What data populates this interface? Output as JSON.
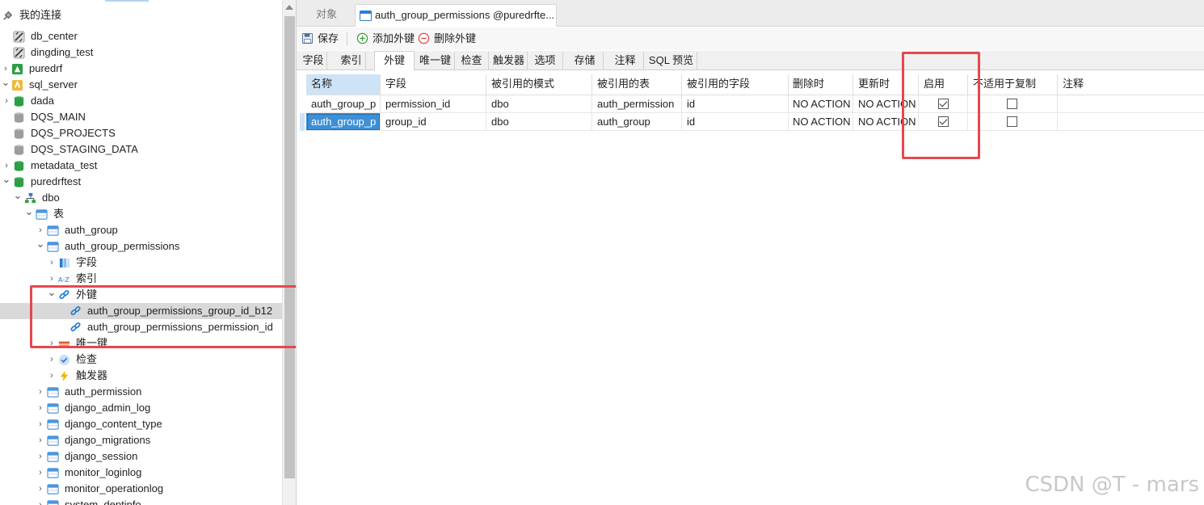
{
  "tree": {
    "root_label": "我的连接",
    "rows": [
      {
        "label": "db_center",
        "icon": "connection-disabled-icon",
        "twisty": ""
      },
      {
        "label": "dingding_test",
        "icon": "connection-disabled-icon",
        "twisty": ""
      },
      {
        "label": "puredrf",
        "icon": "connection-green-icon",
        "twisty": ">"
      },
      {
        "label": "sql_server",
        "icon": "connection-active-icon",
        "twisty": "v"
      },
      {
        "label": "dada",
        "icon": "database-green-icon",
        "twisty": ">"
      },
      {
        "label": "DQS_MAIN",
        "icon": "database-gray-icon",
        "twisty": ""
      },
      {
        "label": "DQS_PROJECTS",
        "icon": "database-gray-icon",
        "twisty": ""
      },
      {
        "label": "DQS_STAGING_DATA",
        "icon": "database-gray-icon",
        "twisty": ""
      },
      {
        "label": "metadata_test",
        "icon": "database-green-icon",
        "twisty": ">"
      },
      {
        "label": "puredrftest",
        "icon": "database-green-icon",
        "twisty": "v"
      },
      {
        "label": "dbo",
        "icon": "schema-icon",
        "twisty": "v"
      },
      {
        "label": "表",
        "icon": "tables-folder-icon",
        "twisty": "v"
      },
      {
        "label": "auth_group",
        "icon": "table-icon",
        "twisty": ">"
      },
      {
        "label": "auth_group_permissions",
        "icon": "table-icon",
        "twisty": "v"
      },
      {
        "label": "字段",
        "icon": "fields-icon",
        "twisty": ">"
      },
      {
        "label": "索引",
        "icon": "index-az-icon",
        "twisty": ">"
      },
      {
        "label": "外键",
        "icon": "foreign-key-icon",
        "twisty": "v"
      },
      {
        "label": "auth_group_permissions_group_id_b12",
        "icon": "foreign-key-icon",
        "twisty": ""
      },
      {
        "label": "auth_group_permissions_permission_id",
        "icon": "foreign-key-icon",
        "twisty": ""
      },
      {
        "label": "唯一键",
        "icon": "unique-key-icon",
        "twisty": ">"
      },
      {
        "label": "检查",
        "icon": "check-icon",
        "twisty": ">"
      },
      {
        "label": "触发器",
        "icon": "trigger-icon",
        "twisty": ">"
      },
      {
        "label": "auth_permission",
        "icon": "table-icon",
        "twisty": ">"
      },
      {
        "label": "django_admin_log",
        "icon": "table-icon",
        "twisty": ">"
      },
      {
        "label": "django_content_type",
        "icon": "table-icon",
        "twisty": ">"
      },
      {
        "label": "django_migrations",
        "icon": "table-icon",
        "twisty": ">"
      },
      {
        "label": "django_session",
        "icon": "table-icon",
        "twisty": ">"
      },
      {
        "label": "monitor_loginlog",
        "icon": "table-icon",
        "twisty": ">"
      },
      {
        "label": "monitor_operationlog",
        "icon": "table-icon",
        "twisty": ">"
      },
      {
        "label": "system_deptinfo",
        "icon": "table-icon",
        "twisty": ">"
      }
    ]
  },
  "tabs": {
    "objects": "对象",
    "current": "auth_group_permissions @puredrfte..."
  },
  "toolbar": {
    "save": "保存",
    "add_fk": "添加外键",
    "delete_fk": "删除外键"
  },
  "subtabs": [
    "字段",
    "索引",
    "外键",
    "唯一键",
    "检查",
    "触发器",
    "选项",
    "存储",
    "注释",
    "SQL 预览"
  ],
  "grid": {
    "headers": [
      "名称",
      "字段",
      "被引用的模式",
      "被引用的表",
      "被引用的字段",
      "删除时",
      "更新时",
      "启用",
      "不适用于复制",
      "注释"
    ],
    "rows": [
      {
        "name": "auth_group_p",
        "field": "permission_id",
        "ref_schema": "dbo",
        "ref_table": "auth_permission",
        "ref_field": "id",
        "on_delete": "NO ACTION",
        "on_update": "NO ACTION",
        "enabled": true,
        "not_for_replication": false,
        "comment": ""
      },
      {
        "name": "auth_group_p",
        "field": "group_id",
        "ref_schema": "dbo",
        "ref_table": "auth_group",
        "ref_field": "id",
        "on_delete": "NO ACTION",
        "on_update": "NO ACTION",
        "enabled": true,
        "not_for_replication": false,
        "comment": ""
      }
    ]
  },
  "watermark": "CSDN @T - mars",
  "colors": {
    "highlight_red": "#e5484d",
    "selection_blue": "#3d8fd6",
    "header_blue": "#cfe3f7"
  }
}
